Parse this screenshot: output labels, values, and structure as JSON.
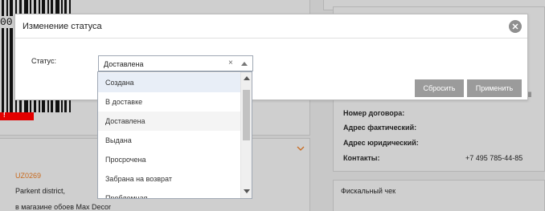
{
  "background": {
    "barcode_digits": "00",
    "red_badge": "!",
    "order_code": "UZ0269",
    "address_lines": [
      "Parkent district,",
      "в магазине обоев Max Decor"
    ],
    "info": {
      "contract_label": "Номер договора:",
      "actual_address_label": "Адрес фактический:",
      "legal_address_label": "Адрес юридический:",
      "contacts_label": "Контакты:",
      "contacts_value": "+7 495 785-44-85"
    },
    "fiscal_receipt_title": "Фискальный чек",
    "partial_text": "ll"
  },
  "modal": {
    "title": "Изменение статуса",
    "status_label": "Статус:",
    "select": {
      "value": "Доставлена",
      "clear_glyph": "×"
    },
    "reset_label": "Сбросить",
    "apply_label": "Применить"
  },
  "dropdown": {
    "options": [
      "Создана",
      "В доставке",
      "Доставлена",
      "Выдана",
      "Просрочена",
      "Забрана на возврат",
      "Проблемная"
    ],
    "highlighted_option": "Создана",
    "selected_option": "Доставлена"
  },
  "colors": {
    "overlay_gray": "#c8c8c8",
    "accent_orange": "#c96a1e",
    "button_gray": "#9b9b9b",
    "highlight_blue": "#e8eef7"
  },
  "icons": {
    "close": "close-icon",
    "chevron": "chevron-down-icon",
    "clear": "clear-icon",
    "arrow": "arrow-up-icon"
  }
}
